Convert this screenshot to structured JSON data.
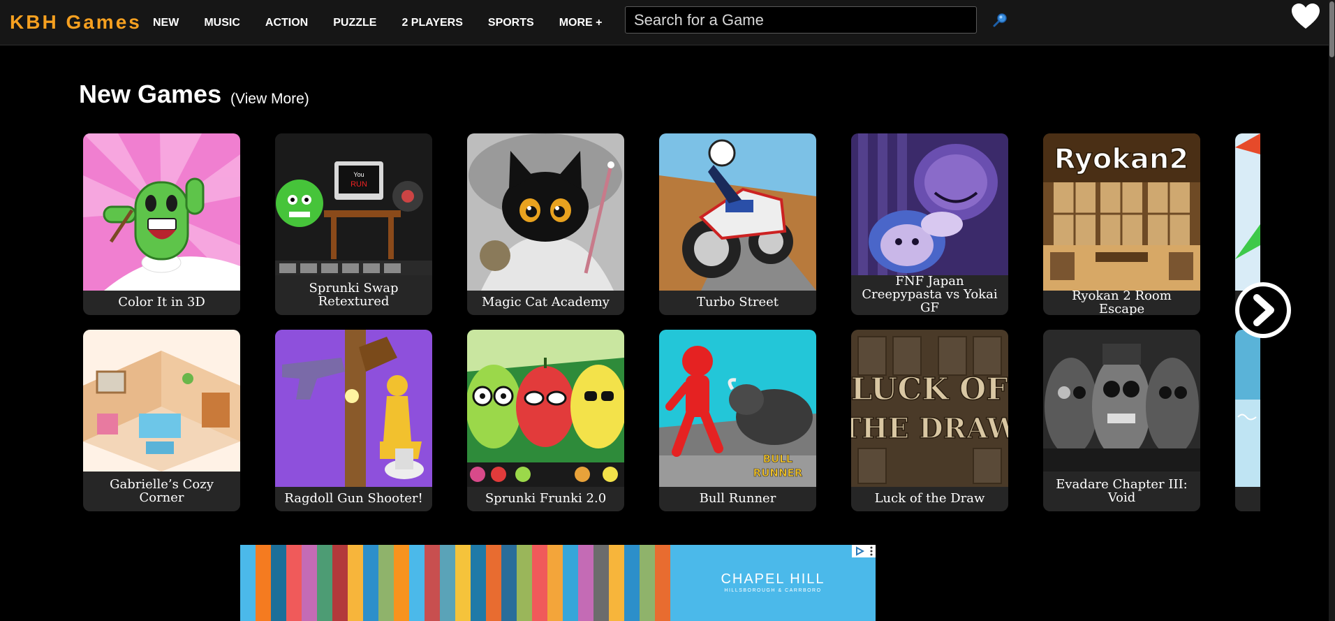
{
  "header": {
    "logo": "KBH Games",
    "nav": [
      "NEW",
      "MUSIC",
      "ACTION",
      "PUZZLE",
      "2 PLAYERS",
      "SPORTS",
      "MORE +"
    ],
    "search_placeholder": "Search for a Game",
    "accent_color": "#f6a020"
  },
  "section": {
    "title": "New Games",
    "view_more": "(View More)"
  },
  "games_row1": [
    {
      "title": "Color It in 3D",
      "colors": [
        "#f07fd0",
        "#5ec44a"
      ]
    },
    {
      "title": "Sprunki Swap Retextured",
      "colors": [
        "#1a1a1a",
        "#46c43a"
      ]
    },
    {
      "title": "Magic Cat Academy",
      "colors": [
        "#cfcfcf",
        "#111111"
      ]
    },
    {
      "title": "Turbo Street",
      "colors": [
        "#b87a3c",
        "#e8e8e8"
      ]
    },
    {
      "title": "FNF Japan Creepypasta vs Yokai GF",
      "colors": [
        "#3b2a6a",
        "#8a6bc9"
      ]
    },
    {
      "title": "Ryokan 2 Room Escape",
      "colors": [
        "#6e4a25",
        "#d7a866"
      ]
    }
  ],
  "games_row2": [
    {
      "title": "Gabrielle’s Cozy Corner",
      "colors": [
        "#f3d6b8",
        "#6dc6e8"
      ]
    },
    {
      "title": "Ragdoll Gun Shooter!",
      "colors": [
        "#9b5de5",
        "#f2c12e"
      ]
    },
    {
      "title": "Sprunki Frunki 2.0",
      "colors": [
        "#2e8b3a",
        "#e23b3b"
      ]
    },
    {
      "title": "Bull Runner",
      "colors": [
        "#23c6d8",
        "#e52222"
      ]
    },
    {
      "title": "Luck of the Draw",
      "colors": [
        "#4a3a28",
        "#d9c7a3"
      ]
    },
    {
      "title": "Evadare Chapter III: Void",
      "colors": [
        "#2a2a2a",
        "#bdbdbd"
      ]
    }
  ],
  "thumb_texts": {
    "sprunki_screen": "You RUN",
    "ryokan": "Ryokan2",
    "luck_line1": "LUCK OF",
    "luck_line2": "THE DRAW",
    "bull_line1": "BULL",
    "bull_line2": "RUNNER"
  },
  "ad": {
    "brand": "CHAPEL HILL",
    "sub": "HILLSBOROUGH & CARRBORO",
    "stripes": [
      "#4bb9ea",
      "#f57b20",
      "#1c6f99",
      "#f05a5a",
      "#c46bb5",
      "#4d9c74",
      "#b3393b",
      "#f7b53b",
      "#2c8fca",
      "#8fb36b",
      "#f7931e",
      "#4bb9ea",
      "#c84f4f",
      "#5aa3b8",
      "#f5c33b",
      "#1f7aa8",
      "#e86c30",
      "#2a6d9a",
      "#9ab65a",
      "#f05a5a",
      "#f3a53a",
      "#36a6d9",
      "#c46bb5",
      "#6c6c6c",
      "#f7b53b",
      "#2c8fca",
      "#8fb36b",
      "#e86c30"
    ]
  }
}
